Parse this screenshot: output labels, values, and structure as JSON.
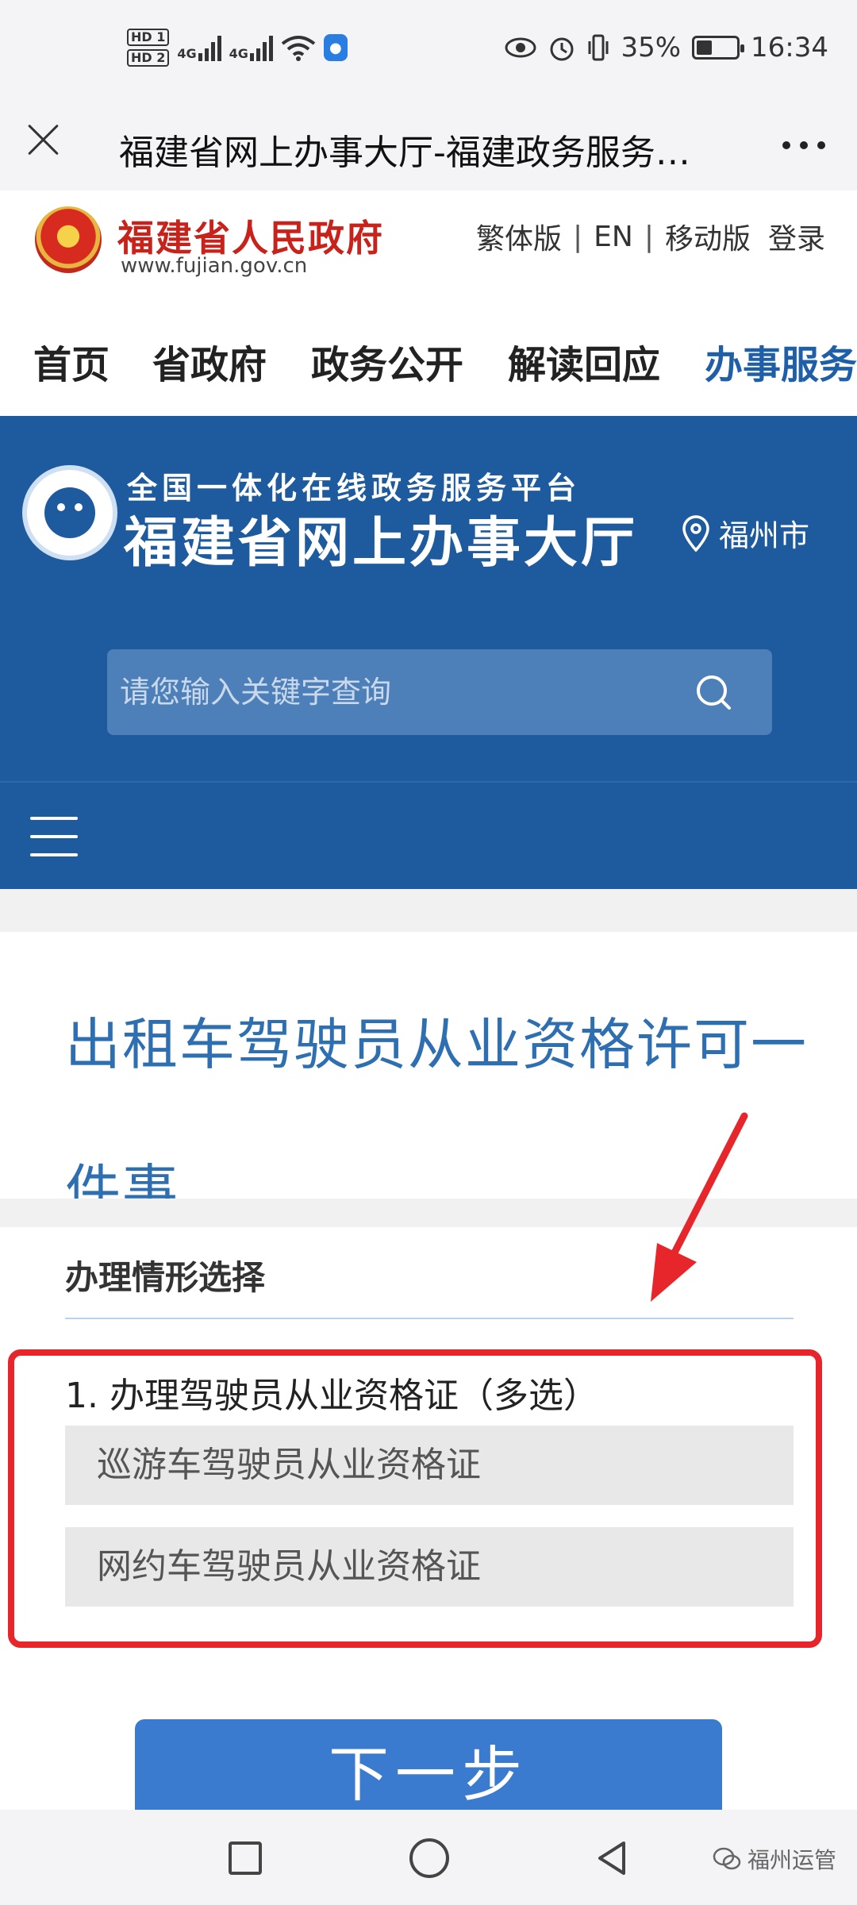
{
  "status_bar": {
    "hd1": "HD 1",
    "hd2": "HD 2",
    "net1": "4G",
    "net2": "4G",
    "battery_percent": "35%",
    "time": "16:34"
  },
  "browser": {
    "title": "福建省网上办事大厅-福建政务服务…"
  },
  "gov_header": {
    "name": "福建省人民政府",
    "url": "www.fujian.gov.cn",
    "links": [
      "繁体版",
      "EN",
      "移动版"
    ],
    "login": "登录"
  },
  "nav": {
    "items": [
      "首页",
      "省政府",
      "政务公开",
      "解读回应",
      "办事服务"
    ]
  },
  "banner": {
    "subtitle": "全国一体化在线政务服务平台",
    "title": "福建省网上办事大厅",
    "location": "福州市"
  },
  "search": {
    "placeholder": "请您输入关键字查询"
  },
  "service": {
    "title": "出租车驾驶员从业资格许可一件事"
  },
  "form": {
    "section_heading": "办理情形选择",
    "question": "1. 办理驾驶员从业资格证（多选）",
    "options": [
      "巡游车驾驶员从业资格证",
      "网约车驾驶员从业资格证"
    ],
    "next_label": "下一步"
  },
  "watermark": {
    "text": "福州运管"
  },
  "colors": {
    "banner_blue": "#1e5b9e",
    "title_blue": "#2e6fb2",
    "highlight_red": "#e6262a",
    "button_blue": "#3a7bd0"
  }
}
